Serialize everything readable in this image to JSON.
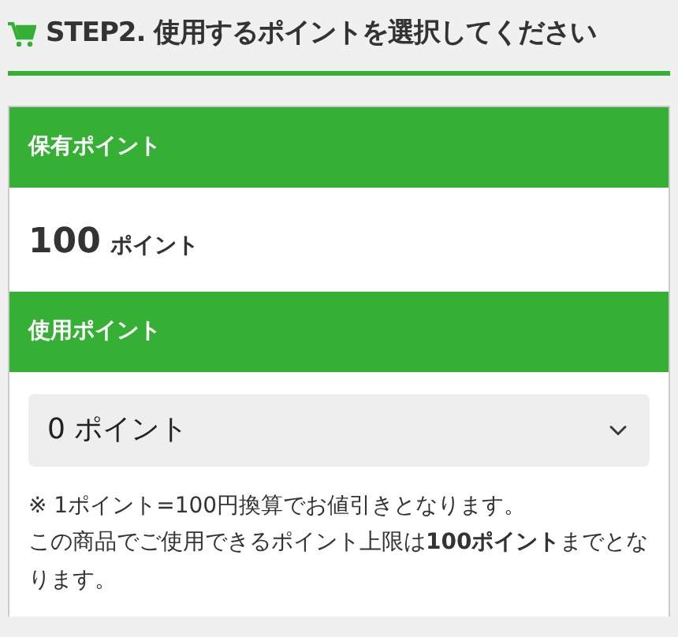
{
  "heading": "STEP2. 使用するポイントを選択してください",
  "owned": {
    "title": "保有ポイント",
    "amount": "100",
    "unit": "ポイント"
  },
  "use": {
    "title": "使用ポイント",
    "value": "0 ポイント"
  },
  "notes": [
    "※ 1ポイント=100円換算でお値引きとなります。",
    "この商品でご使用できるポイント上限は**100ポイント**までとなります。"
  ]
}
